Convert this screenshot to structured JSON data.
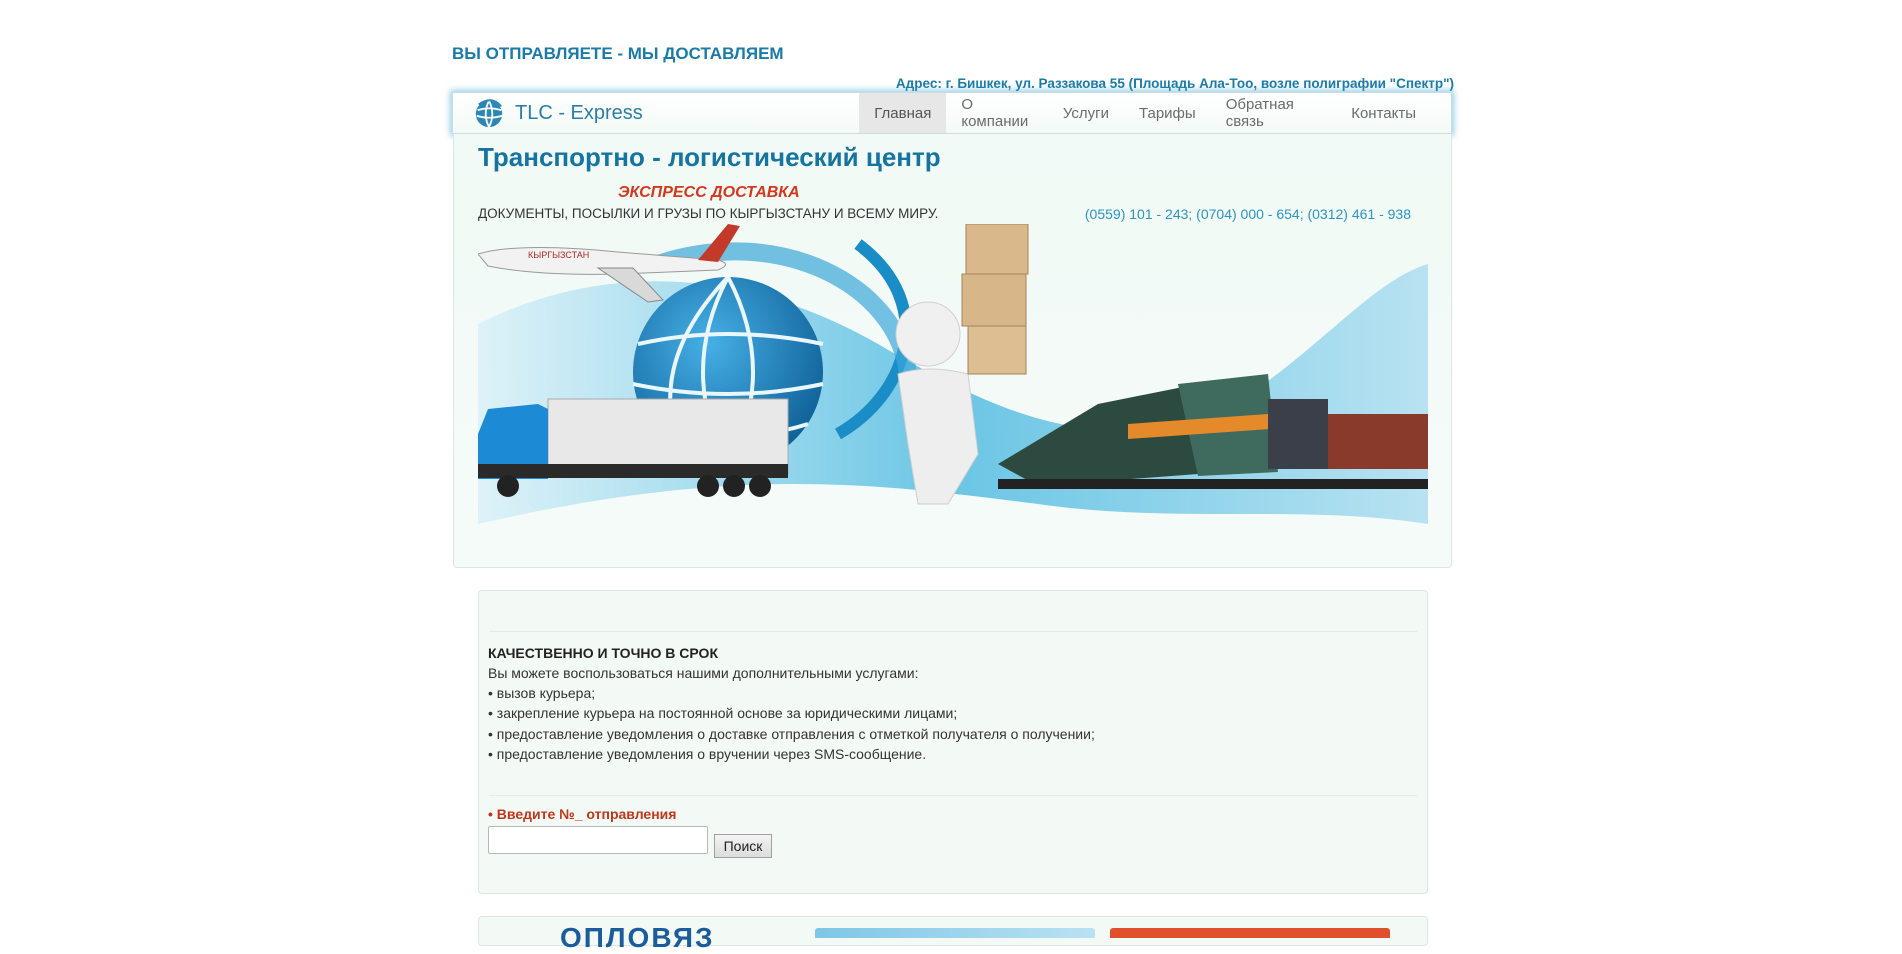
{
  "header": {
    "slogan": "ВЫ ОТПРАВЛЯЕТЕ - МЫ ДОСТАВЛЯЕМ",
    "address": "Адрес: г. Бишкек, ул. Раззакова 55 (Площадь Ала-Тоо, возле полиграфии \"Спектр\")"
  },
  "nav": {
    "brand": "TLC - Express",
    "items": [
      {
        "label": "Главная",
        "active": true
      },
      {
        "label": "О компании"
      },
      {
        "label": "Услуги"
      },
      {
        "label": "Тарифы"
      },
      {
        "label": "Обратная связь"
      },
      {
        "label": "Контакты"
      }
    ]
  },
  "hero": {
    "title": "Транспортно - логистический центр",
    "express": "ЭКСПРЕСС ДОСТАВКА",
    "docs": "ДОКУМЕНТЫ, ПОСЫЛКИ И ГРУЗЫ ПО КЫРГЫЗСТАНУ И ВСЕМУ МИРУ.",
    "phones": "(0559) 101 - 243; (0704) 000 - 654; (0312) 461 - 938",
    "plane_text": "КЫРГЫЗСТАН"
  },
  "content": {
    "heading": "КАЧЕСТВЕННО И ТОЧНО В СРОК",
    "intro": "Вы можете воспользоваться нашими дополнительными услугами:",
    "services": [
      "• вызов курьера;",
      "• закрепление курьера на постоянной основе за юридическими лицами;",
      "• предоставление уведомления о доставке отправления с отметкой получателя о получении;",
      "• предоставление уведомления о вручении через SMS-сообщение."
    ],
    "tracking_bullet": "• ",
    "tracking_label": "Введите №_ отправления",
    "tracking_value": "",
    "search_button": "Поиск"
  },
  "footer": {
    "promo_partial": "ОПЛОВЯЗ"
  },
  "colors": {
    "accent": "#1674a0",
    "express_red": "#d4371c",
    "phone_blue": "#2d94c4",
    "panel_bg": "#f3faf5"
  }
}
